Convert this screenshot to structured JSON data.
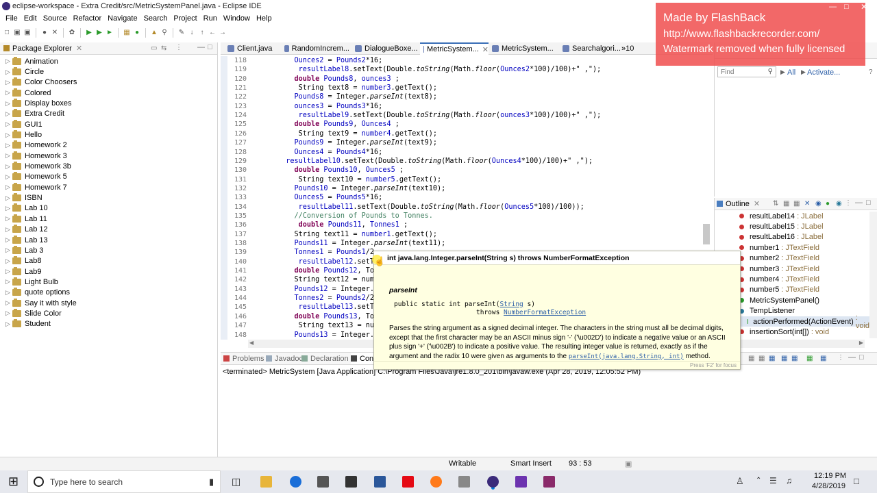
{
  "window": {
    "title": "eclipse-workspace - Extra Credit/src/MetricSystemPanel.java - Eclipse IDE"
  },
  "menu": [
    "File",
    "Edit",
    "Source",
    "Refactor",
    "Navigate",
    "Search",
    "Project",
    "Run",
    "Window",
    "Help"
  ],
  "package_explorer": {
    "title": "Package Explorer",
    "projects": [
      "Animation",
      "Circle",
      "Color Choosers",
      "Colored",
      "Display boxes",
      "Extra Credit",
      "GUI1",
      "Hello",
      "Homework 2",
      "Homework 3",
      "Homework 3b",
      "Homework 5",
      "Homework 7",
      "ISBN",
      "Lab 10",
      "Lab 11",
      "Lab 12",
      "Lab 13",
      "Lab 3",
      "Lab8",
      "Lab9",
      "Light Bulb",
      "quote options",
      "Say it with style",
      "Slide Color",
      "Student"
    ]
  },
  "editor_tabs": [
    "Client.java",
    "RandomIncrem...",
    "DialogueBoxe...",
    "MetricSystem...",
    "MetricSystem...",
    "Searchalgori...",
    "»10"
  ],
  "editor": {
    "lines": [
      {
        "n": "118",
        "code": "           Ounces2 = Pounds2*16;"
      },
      {
        "n": "119",
        "code": "            resultLabel8.setText(Double.toString(Math.floor(Ounces2*100)/100)+\" ,\");"
      },
      {
        "n": "120",
        "code": "           double Pounds8, ounces3 ;"
      },
      {
        "n": "121",
        "code": "            String text8 = number3.getText();"
      },
      {
        "n": "122",
        "code": "           Pounds8 = Integer.parseInt(text8);"
      },
      {
        "n": "123",
        "code": "           ounces3 = Pounds3*16;"
      },
      {
        "n": "124",
        "code": "            resultLabel9.setText(Double.toString(Math.floor(ounces3*100)/100)+\" ,\");"
      },
      {
        "n": "125",
        "code": "           double Pounds9, Ounces4 ;"
      },
      {
        "n": "126",
        "code": "            String text9 = number4.getText();"
      },
      {
        "n": "127",
        "code": "           Pounds9 = Integer.parseInt(text9);"
      },
      {
        "n": "128",
        "code": "           Ounces4 = Pounds4*16;"
      },
      {
        "n": "129",
        "code": "         resultLabel10.setText(Double.toString(Math.floor(Ounces4*100)/100)+\" ,\");"
      },
      {
        "n": "130",
        "code": "           double Pounds10, Ounces5 ;"
      },
      {
        "n": "131",
        "code": "            String text10 = number5.getText();"
      },
      {
        "n": "132",
        "code": "           Pounds10 = Integer.parseInt(text10);"
      },
      {
        "n": "133",
        "code": "           Ounces5 = Pounds5*16;"
      },
      {
        "n": "134",
        "code": "            resultLabel11.setText(Double.toString(Math.floor(Ounces5*100)/100));"
      },
      {
        "n": "135",
        "code": "           //Conversion of Pounds to Tonnes."
      },
      {
        "n": "136",
        "code": "            double Pounds11, Tonnes1 ;"
      },
      {
        "n": "137",
        "code": "           String text11 = number1.getText();"
      },
      {
        "n": "138",
        "code": "           Pounds11 = Integer.parseInt(text11);"
      },
      {
        "n": "139",
        "code": "           Tonnes1 = Pounds1/2"
      },
      {
        "n": "140",
        "code": "            resultLabel12.setT"
      },
      {
        "n": "141",
        "code": "           double Pounds12, To"
      },
      {
        "n": "142",
        "code": "           String text12 = num"
      },
      {
        "n": "143",
        "code": "           Pounds12 = Integer."
      },
      {
        "n": "144",
        "code": "           Tonnes2 = Pounds2/2"
      },
      {
        "n": "145",
        "code": "            resultLabel13.setT"
      },
      {
        "n": "146",
        "code": "           double Pounds13, To"
      },
      {
        "n": "147",
        "code": "            String text13 = nu"
      },
      {
        "n": "148",
        "code": "           Pounds13 = Integer."
      }
    ]
  },
  "right_panel": {
    "find_placeholder": "Find",
    "all_label": "All",
    "activate_label": "Activate..."
  },
  "outline": {
    "title": "Outline",
    "items": [
      {
        "name": "resultLabel14",
        "type": ": JLabel"
      },
      {
        "name": "resultLabel15",
        "type": ": JLabel"
      },
      {
        "name": "resultLabel16",
        "type": ": JLabel"
      },
      {
        "name": "number1",
        "type": ": JTextField"
      },
      {
        "name": "number2",
        "type": ": JTextField"
      },
      {
        "name": "number3",
        "type": ": JTextField"
      },
      {
        "name": "number4",
        "type": ": JTextField"
      },
      {
        "name": "number5",
        "type": ": JTextField"
      },
      {
        "name": "MetricSystemPanel()",
        "type": ""
      },
      {
        "name": "TempListener",
        "type": ""
      },
      {
        "name": "actionPerformed(ActionEvent)",
        "type": ": void"
      },
      {
        "name": "insertionSort(int[])",
        "type": ": void"
      }
    ]
  },
  "bottom_tabs": [
    "Problems",
    "Javadoc",
    "Declaration",
    "Con"
  ],
  "console": {
    "text": "<terminated> MetricSystem [Java Application] C:\\Program Files\\Java\\jre1.8.0_201\\bin\\javaw.exe (Apr 28, 2019, 12:05:52 PM)"
  },
  "status": {
    "writable": "Writable",
    "insert": "Smart Insert",
    "position": "93 : 53"
  },
  "tooltip": {
    "header": "int java.lang.Integer.parseInt(String s) throws NumberFormatException",
    "method": "parseInt",
    "sig1": "public static int parseInt(",
    "sig_type": "String",
    "sig_param": " s)",
    "sig2": "throws ",
    "sig_exc": "NumberFormatException",
    "desc1": "Parses the string argument as a signed decimal integer. The characters in the string must all be decimal digits,",
    "desc2": "except that the first character may be an ASCII minus sign '-' ('\\u002D') to indicate a negative value or an ASCII",
    "desc3": "plus sign '+' ('\\u002B') to indicate a positive value. The resulting integer value is returned, exactly as if the",
    "desc4": "argument and the radix 10 were given as arguments to the",
    "desc4_link": "parseInt(java.lang.String, int)",
    "desc4_end": " method.",
    "footer": "Press 'F2' for focus"
  },
  "watermark": {
    "line1": "Made by FlashBack",
    "line2": "http://www.flashbackrecorder.com/",
    "line3": "Watermark removed when fully licensed"
  },
  "taskbar": {
    "search_placeholder": "Type here to search",
    "time": "12:19 PM",
    "date": "4/28/2019"
  },
  "colors": {
    "accent": "#0078d7",
    "watermark": "#f04e4e",
    "tooltip_bg": "#ffffe1"
  }
}
